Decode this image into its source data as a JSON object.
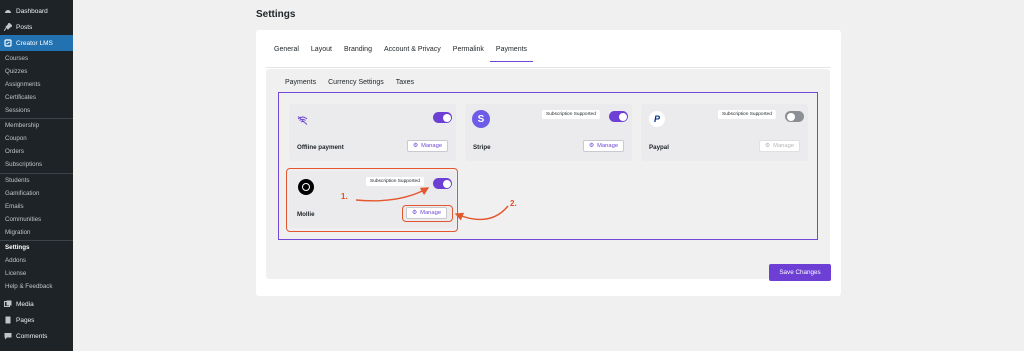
{
  "sidebar": {
    "top_items": [
      {
        "label": "Dashboard",
        "icon": "dashboard-icon"
      },
      {
        "label": "Posts",
        "icon": "pin-icon"
      },
      {
        "label": "Creator LMS",
        "icon": "lms-icon"
      }
    ],
    "sub_items_group1": [
      "Courses",
      "Quizzes",
      "Assignments",
      "Certificates",
      "Sessions"
    ],
    "sub_items_group2": [
      "Membership",
      "Coupon",
      "Orders",
      "Subscriptions"
    ],
    "sub_items_group3": [
      "Students",
      "Gamification",
      "Emails",
      "Communities",
      "Migration"
    ],
    "sub_items_group4": [
      "Settings",
      "Addons",
      "License",
      "Help & Feedback"
    ],
    "bottom_items": [
      {
        "label": "Media",
        "icon": "media-icon"
      },
      {
        "label": "Pages",
        "icon": "pages-icon"
      },
      {
        "label": "Comments",
        "icon": "comments-icon"
      }
    ]
  },
  "page": {
    "title": "Settings"
  },
  "tabs": [
    "General",
    "Layout",
    "Branding",
    "Account & Privacy",
    "Permalink",
    "Payments"
  ],
  "active_tab": "Payments",
  "subtabs": [
    "Payments",
    "Currency Settings",
    "Taxes"
  ],
  "gateways": [
    {
      "name": "Offline payment",
      "badge": "",
      "enabled": true,
      "manage": "Manage",
      "manage_enabled": true
    },
    {
      "name": "Stripe",
      "badge": "Subscription Supported",
      "enabled": true,
      "manage": "Manage",
      "manage_enabled": true
    },
    {
      "name": "Paypal",
      "badge": "Subscription Supported",
      "enabled": false,
      "manage": "Manage",
      "manage_enabled": false
    },
    {
      "name": "Mollie",
      "badge": "Subscription Supported",
      "enabled": true,
      "manage": "Manage",
      "manage_enabled": true
    }
  ],
  "annotations": [
    "1.",
    "2."
  ],
  "save_label": "Save Changes",
  "colors": {
    "accent": "#6d3fd4",
    "highlight": "#e4572e",
    "sidebar_bg": "#1d2327",
    "sidebar_active": "#2271b1"
  }
}
